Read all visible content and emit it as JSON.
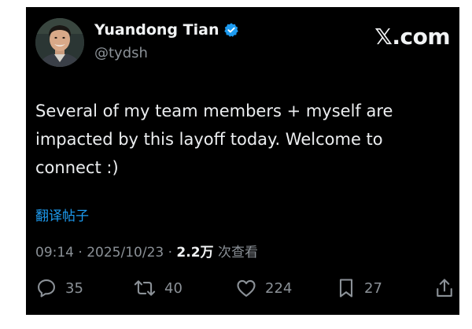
{
  "author": {
    "display_name": "Yuandong Tian",
    "handle": "@tydsh",
    "verified": true
  },
  "brand": {
    "symbol": "𝕏",
    "suffix": ".com"
  },
  "tweet": {
    "text": "Several of my team members + myself are impacted by this layoff today. Welcome to connect :)",
    "translate_label": "翻译帖子"
  },
  "meta": {
    "time": "09:14",
    "separator": "·",
    "date": "2025/10/23",
    "views_count": "2.2万",
    "views_label": "次查看"
  },
  "actions": {
    "replies": "35",
    "reposts": "40",
    "likes": "224",
    "bookmarks": "27"
  },
  "colors": {
    "background": "#000000",
    "text": "#e7e9ea",
    "secondary": "#8b9197",
    "link": "#1d9bf0",
    "verified": "#1d9bf0"
  },
  "icons": {
    "reply": "speech-bubble-icon",
    "repost": "repost-arrows-icon",
    "like": "heart-icon",
    "bookmark": "bookmark-icon",
    "share": "share-upload-icon"
  }
}
